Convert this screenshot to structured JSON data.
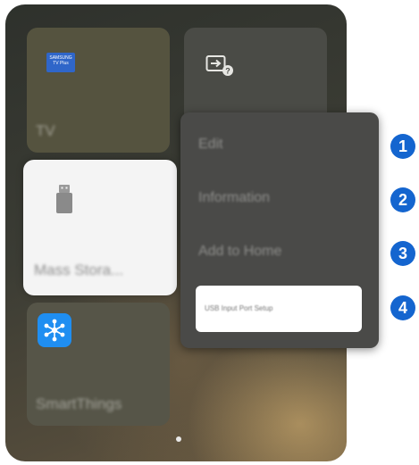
{
  "tiles": {
    "tv": {
      "label": "TV",
      "brand_line1": "SAMSUNG",
      "brand_line2": "TV Plus"
    },
    "input": {
      "icon": "source-input-icon"
    },
    "usb": {
      "label": "Mass Stora...",
      "icon": "usb-drive-icon"
    },
    "smartthings": {
      "label": "SmartThings",
      "icon": "smartthings-icon",
      "icon_color": "#1f8ef1"
    }
  },
  "menu": {
    "items": [
      {
        "label": "Edit"
      },
      {
        "label": "Information"
      },
      {
        "label": "Add to Home"
      },
      {
        "label": "USB Input Port Setup",
        "selected": true
      }
    ]
  },
  "callouts": [
    "1",
    "2",
    "3",
    "4"
  ],
  "colors": {
    "callout": "#1465cf",
    "menu_bg": "#4a4a48"
  }
}
